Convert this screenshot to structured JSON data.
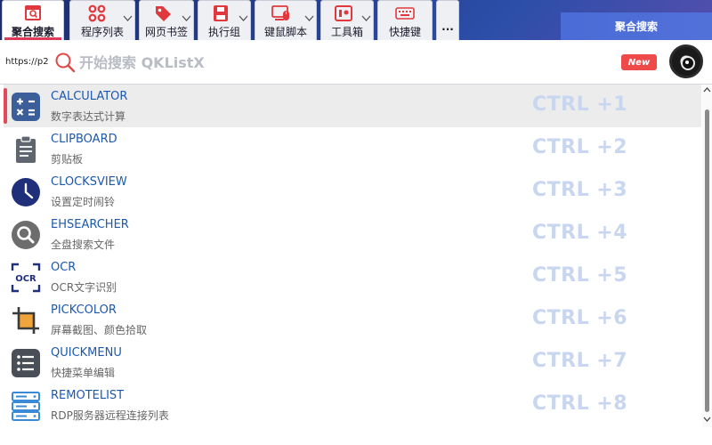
{
  "tabs": [
    {
      "label": "聚合搜索",
      "icon": "search-window-icon",
      "active": true
    },
    {
      "label": "程序列表",
      "icon": "app-grid-icon"
    },
    {
      "label": "网页书签",
      "icon": "bookmark-tag-icon"
    },
    {
      "label": "执行组",
      "icon": "save-disk-icon"
    },
    {
      "label": "键鼠脚本",
      "icon": "keyboard-mouse-icon"
    },
    {
      "label": "工具箱",
      "icon": "toolbox-icon"
    },
    {
      "label": "快捷键",
      "icon": "keyboard-icon"
    },
    {
      "label": "...",
      "icon": "more-icon"
    }
  ],
  "header": {
    "right_title": "聚合搜索"
  },
  "search": {
    "url_text": "https://p2.",
    "placeholder": "开始搜索 QKListX",
    "value": "",
    "new_badge": "New"
  },
  "items": [
    {
      "name": "CALCULATOR",
      "desc": "数字表达式计算",
      "shortcut": "CTRL +1",
      "icon": "calculator-icon",
      "selected": true
    },
    {
      "name": "CLIPBOARD",
      "desc": "剪贴板",
      "shortcut": "CTRL +2",
      "icon": "clipboard-icon"
    },
    {
      "name": "CLOCKSVIEW",
      "desc": "设置定时闹铃",
      "shortcut": "CTRL +3",
      "icon": "clock-icon"
    },
    {
      "name": "EHSEARCHER",
      "desc": "全盘搜索文件",
      "shortcut": "CTRL +4",
      "icon": "magnifier-icon"
    },
    {
      "name": "OCR",
      "desc": "OCR文字识别",
      "shortcut": "CTRL +5",
      "icon": "ocr-icon"
    },
    {
      "name": "PICKCOLOR",
      "desc": "屏幕截图、颜色拾取",
      "shortcut": "CTRL +6",
      "icon": "crop-icon"
    },
    {
      "name": "QUICKMENU",
      "desc": "快捷菜单编辑",
      "shortcut": "CTRL +7",
      "icon": "menu-list-icon"
    },
    {
      "name": "REMOTELIST",
      "desc": "RDP服务器远程连接列表",
      "shortcut": "CTRL +8",
      "icon": "server-icon"
    }
  ],
  "colors": {
    "accent": "#e24a5c",
    "link_blue": "#1c58b0",
    "shortcut": "#c8d6f0",
    "new_badge": "#ef4a4a",
    "tab_red": "#e0383c"
  }
}
